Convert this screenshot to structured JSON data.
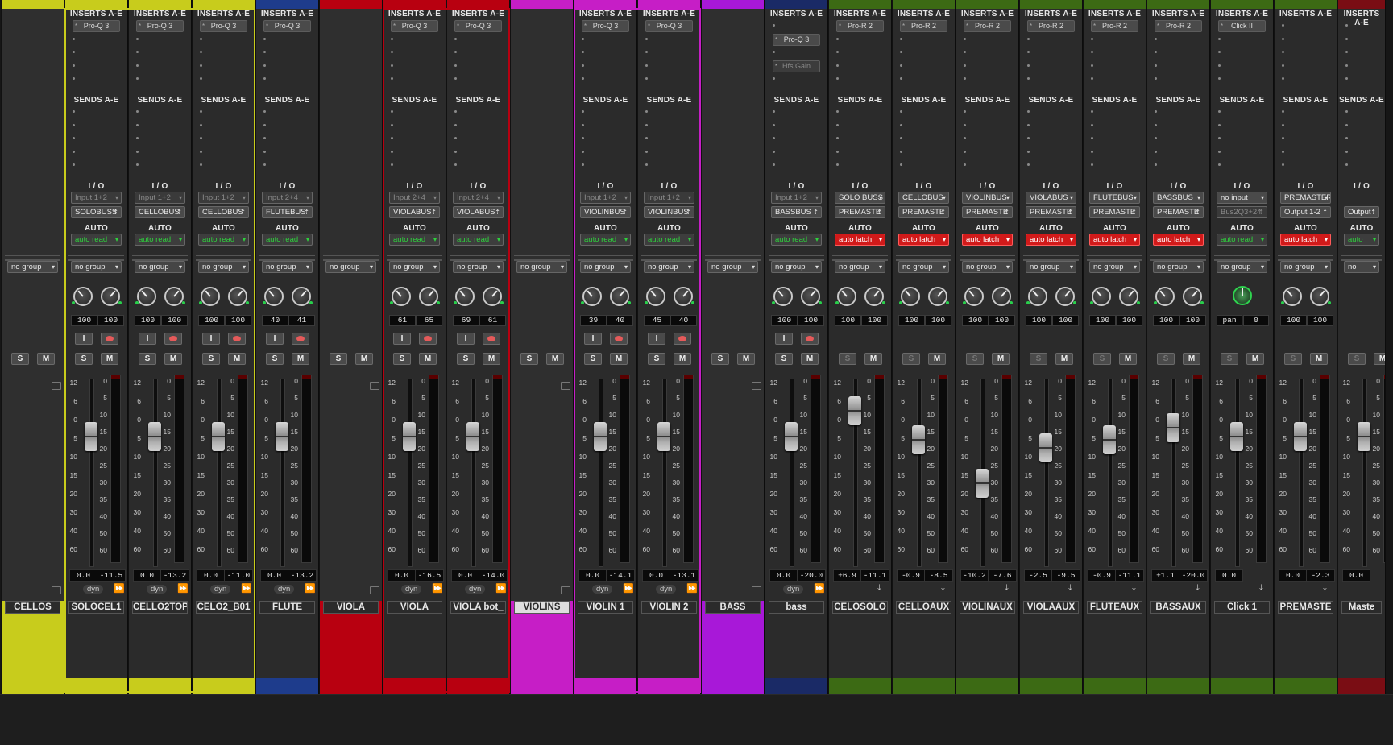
{
  "labels": {
    "inserts": "INSERTS A-E",
    "sends": "SENDS A-E",
    "io": "I / O",
    "auto": "AUTO",
    "solo": "S",
    "mute": "M",
    "dyn": "dyn",
    "scale_left": [
      "12",
      "6",
      "0",
      "5",
      "10",
      "15",
      "20",
      "30",
      "40",
      "60"
    ],
    "scale_right": [
      "0",
      "5",
      "10",
      "15",
      "20",
      "25",
      "30",
      "35",
      "40",
      "50",
      "60"
    ]
  },
  "colors": {
    "yellow": "#c8cc1c",
    "blue": "#1e3c8c",
    "red": "#b80010",
    "magenta": "#c61ec6",
    "purple": "#a818d8",
    "navy": "#1a2a66",
    "green": "#3c6a14",
    "darkred": "#7a0d14",
    "auto_read": "#2ed13d",
    "auto_latch": "#d11a1a"
  },
  "strips": [
    {
      "type": "folder",
      "name": "CELLOS",
      "color": "yellow",
      "group": "no group",
      "selected": true
    },
    {
      "type": "audio",
      "name": "SOLOCEL1",
      "color": "yellow",
      "plugins": [
        "Pro-Q 3"
      ],
      "input": "Input 1+2",
      "output": "SOLOBUSS",
      "auto": "auto read",
      "autoStyle": "read",
      "group": "no group",
      "pan": [
        "100",
        "100"
      ],
      "rec": true,
      "vol": "0.0",
      "peak": "-11.5",
      "fader": 0.3,
      "selected": true
    },
    {
      "type": "audio",
      "name": "CELLO2TOP",
      "color": "yellow",
      "plugins": [
        "Pro-Q 3"
      ],
      "input": "Input 1+2",
      "output": "CELLOBUS",
      "auto": "auto read",
      "autoStyle": "read",
      "group": "no group",
      "pan": [
        "100",
        "100"
      ],
      "rec": true,
      "vol": "0.0",
      "peak": "-13.2",
      "fader": 0.3,
      "selected": true
    },
    {
      "type": "audio",
      "name": "CELO2_B01",
      "color": "yellow",
      "plugins": [
        "Pro-Q 3"
      ],
      "input": "Input 1+2",
      "output": "CELLOBUS",
      "auto": "auto read",
      "autoStyle": "read",
      "group": "no group",
      "pan": [
        "100",
        "100"
      ],
      "rec": true,
      "vol": "0.0",
      "peak": "-11.0",
      "fader": 0.3,
      "selected": true
    },
    {
      "type": "audio",
      "name": "FLUTE",
      "color": "blue",
      "plugins": [
        "Pro-Q 3"
      ],
      "input": "Input 2+4",
      "output": "FLUTEBUS",
      "auto": "auto read",
      "autoStyle": "read",
      "group": "no group",
      "pan": [
        "40",
        "41"
      ],
      "rec": true,
      "vol": "0.0",
      "peak": "-13.2",
      "fader": 0.3
    },
    {
      "type": "folder",
      "name": "VIOLA",
      "color": "red",
      "group": "no group",
      "selected": true
    },
    {
      "type": "audio",
      "name": "VIOLA",
      "color": "red",
      "plugins": [
        "Pro-Q 3"
      ],
      "input": "Input 2+4",
      "output": "VIOLABUS",
      "auto": "auto read",
      "autoStyle": "read",
      "group": "no group",
      "pan": [
        "61",
        "65"
      ],
      "rec": true,
      "vol": "0.0",
      "peak": "-16.5",
      "fader": 0.3,
      "selected": true
    },
    {
      "type": "audio",
      "name": "VIOLA bot_",
      "color": "red",
      "plugins": [
        "Pro-Q 3"
      ],
      "input": "Input 2+4",
      "output": "VIOLABUS",
      "auto": "auto read",
      "autoStyle": "read",
      "group": "no group",
      "pan": [
        "69",
        "61"
      ],
      "rec": true,
      "vol": "0.0",
      "peak": "-14.0",
      "fader": 0.3,
      "selected": true
    },
    {
      "type": "folder",
      "name": "VIOLINS",
      "color": "magenta",
      "group": "no group",
      "selected": true,
      "highlight": true
    },
    {
      "type": "audio",
      "name": "VIOLIN 1",
      "color": "magenta",
      "plugins": [
        "Pro-Q 3"
      ],
      "input": "Input 1+2",
      "output": "VIOLINBUS",
      "auto": "auto read",
      "autoStyle": "read",
      "group": "no group",
      "pan": [
        "39",
        "40"
      ],
      "rec": true,
      "vol": "0.0",
      "peak": "-14.1",
      "fader": 0.3,
      "selected": true
    },
    {
      "type": "audio",
      "name": "VIOLIN 2",
      "color": "magenta",
      "plugins": [
        "Pro-Q 3"
      ],
      "input": "Input 1+2",
      "output": "VIOLINBUS",
      "auto": "auto read",
      "autoStyle": "read",
      "group": "no group",
      "pan": [
        "45",
        "40"
      ],
      "rec": true,
      "vol": "0.0",
      "peak": "-13.1",
      "fader": 0.3,
      "selected": true
    },
    {
      "type": "folder",
      "name": "BASS",
      "color": "purple",
      "group": "no group"
    },
    {
      "type": "audio",
      "name": "bass",
      "color": "navy",
      "plugins": [
        "",
        "Pro-Q 3",
        "",
        "Hfs Gain"
      ],
      "input": "Input 1+2",
      "output": "BASSBUS",
      "auto": "auto read",
      "autoStyle": "read",
      "group": "no group",
      "pan": [
        "100",
        "100"
      ],
      "rec": true,
      "vol": "0.0",
      "peak": "-20.0",
      "fader": 0.3
    },
    {
      "type": "aux",
      "name": "CELOSOLO",
      "color": "green",
      "plugins": [
        "Pro-R 2"
      ],
      "input": "SOLO BUSS",
      "output": "PREMASTE",
      "auto": "auto latch",
      "autoStyle": "latch",
      "group": "no group",
      "pan": [
        "100",
        "100"
      ],
      "vol": "+6.9",
      "peak": "-11.1",
      "fader": 0.12
    },
    {
      "type": "aux",
      "name": "CELLOAUX",
      "color": "green",
      "plugins": [
        "Pro-R 2"
      ],
      "input": "CELLOBUS",
      "output": "PREMASTE",
      "auto": "auto latch",
      "autoStyle": "latch",
      "group": "no group",
      "pan": [
        "100",
        "100"
      ],
      "vol": "-0.9",
      "peak": "-8.5",
      "fader": 0.32
    },
    {
      "type": "aux",
      "name": "VIOLINAUX",
      "color": "green",
      "plugins": [
        "Pro-R 2"
      ],
      "input": "VIOLINBUS",
      "output": "PREMASTE",
      "auto": "auto latch",
      "autoStyle": "latch",
      "group": "no group",
      "pan": [
        "100",
        "100"
      ],
      "vol": "-10.2",
      "peak": "-7.6",
      "fader": 0.62
    },
    {
      "type": "aux",
      "name": "VIOLAAUX",
      "color": "green",
      "plugins": [
        "Pro-R 2"
      ],
      "input": "VIOLABUS",
      "output": "PREMASTE",
      "auto": "auto latch",
      "autoStyle": "latch",
      "group": "no group",
      "pan": [
        "100",
        "100"
      ],
      "vol": "-2.5",
      "peak": "-9.5",
      "fader": 0.38
    },
    {
      "type": "aux",
      "name": "FLUTEAUX",
      "color": "green",
      "plugins": [
        "Pro-R 2"
      ],
      "input": "FLUTEBUS",
      "output": "PREMASTE",
      "auto": "auto latch",
      "autoStyle": "latch",
      "group": "no group",
      "pan": [
        "100",
        "100"
      ],
      "vol": "-0.9",
      "peak": "-11.1",
      "fader": 0.32
    },
    {
      "type": "aux",
      "name": "BASSAUX",
      "color": "green",
      "plugins": [
        "Pro-R 2"
      ],
      "input": "BASSBUS",
      "output": "PREMASTE",
      "auto": "auto latch",
      "autoStyle": "latch",
      "group": "no group",
      "pan": [
        "100",
        "100"
      ],
      "vol": "+1.1",
      "peak": "-20.0",
      "fader": 0.24
    },
    {
      "type": "aux",
      "name": "Click 1",
      "color": "green",
      "plugins": [
        "Click II"
      ],
      "input": "no input",
      "output": "Bus2Q3+24",
      "auto": "auto read",
      "autoStyle": "read",
      "group": "no group",
      "panMono": "0",
      "panLabel": "pan",
      "vol": "0.0",
      "peak": "",
      "fader": 0.3,
      "dimS": true
    },
    {
      "type": "aux",
      "name": "PREMASTE",
      "color": "green",
      "plugins": [],
      "input": "PREMASTER",
      "output": "Output 1-2",
      "auto": "auto latch",
      "autoStyle": "latch",
      "group": "no group",
      "pan": [
        "100",
        "100"
      ],
      "vol": "0.0",
      "peak": "-2.3",
      "fader": 0.3
    },
    {
      "type": "aux",
      "name": "Maste",
      "color": "darkred",
      "plugins": [],
      "input": "",
      "output": "Output",
      "auto": "auto",
      "autoStyle": "read",
      "group": "no",
      "pan": [],
      "vol": "0.0",
      "peak": "",
      "fader": 0.3,
      "partial": true
    }
  ]
}
